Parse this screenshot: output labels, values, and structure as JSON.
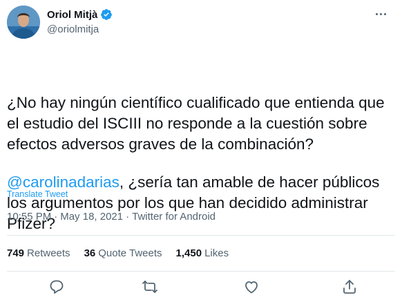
{
  "author": {
    "name": "Oriol Mitjà",
    "handle": "@oriolmitja"
  },
  "tweet": {
    "paragraph1": "¿No hay ningún científico cualificado que entienda que el estudio del ISCIII no responde a la cuestión sobre efectos adversos graves de la combinación?",
    "mention": "@carolinadarias",
    "paragraph2_rest": ", ¿sería tan amable de hacer públicos los argumentos por los que han decidido administrar Pfizer?",
    "translate_label": "Translate Tweet",
    "time": "10:55 PM",
    "separator": "·",
    "date": "May 18, 2021",
    "source": "Twitter for Android"
  },
  "stats": {
    "retweets_count": "749",
    "retweets_label": "Retweets",
    "quotes_count": "36",
    "quotes_label": "Quote Tweets",
    "likes_count": "1,450",
    "likes_label": "Likes"
  },
  "icons": {
    "more": "more-icon",
    "verified": "verified-badge-icon",
    "reply": "reply-icon",
    "retweet": "retweet-icon",
    "like": "like-icon",
    "share": "share-icon"
  },
  "colors": {
    "accent": "#1d9bf0",
    "text": "#0f1419",
    "secondary": "#536471"
  }
}
